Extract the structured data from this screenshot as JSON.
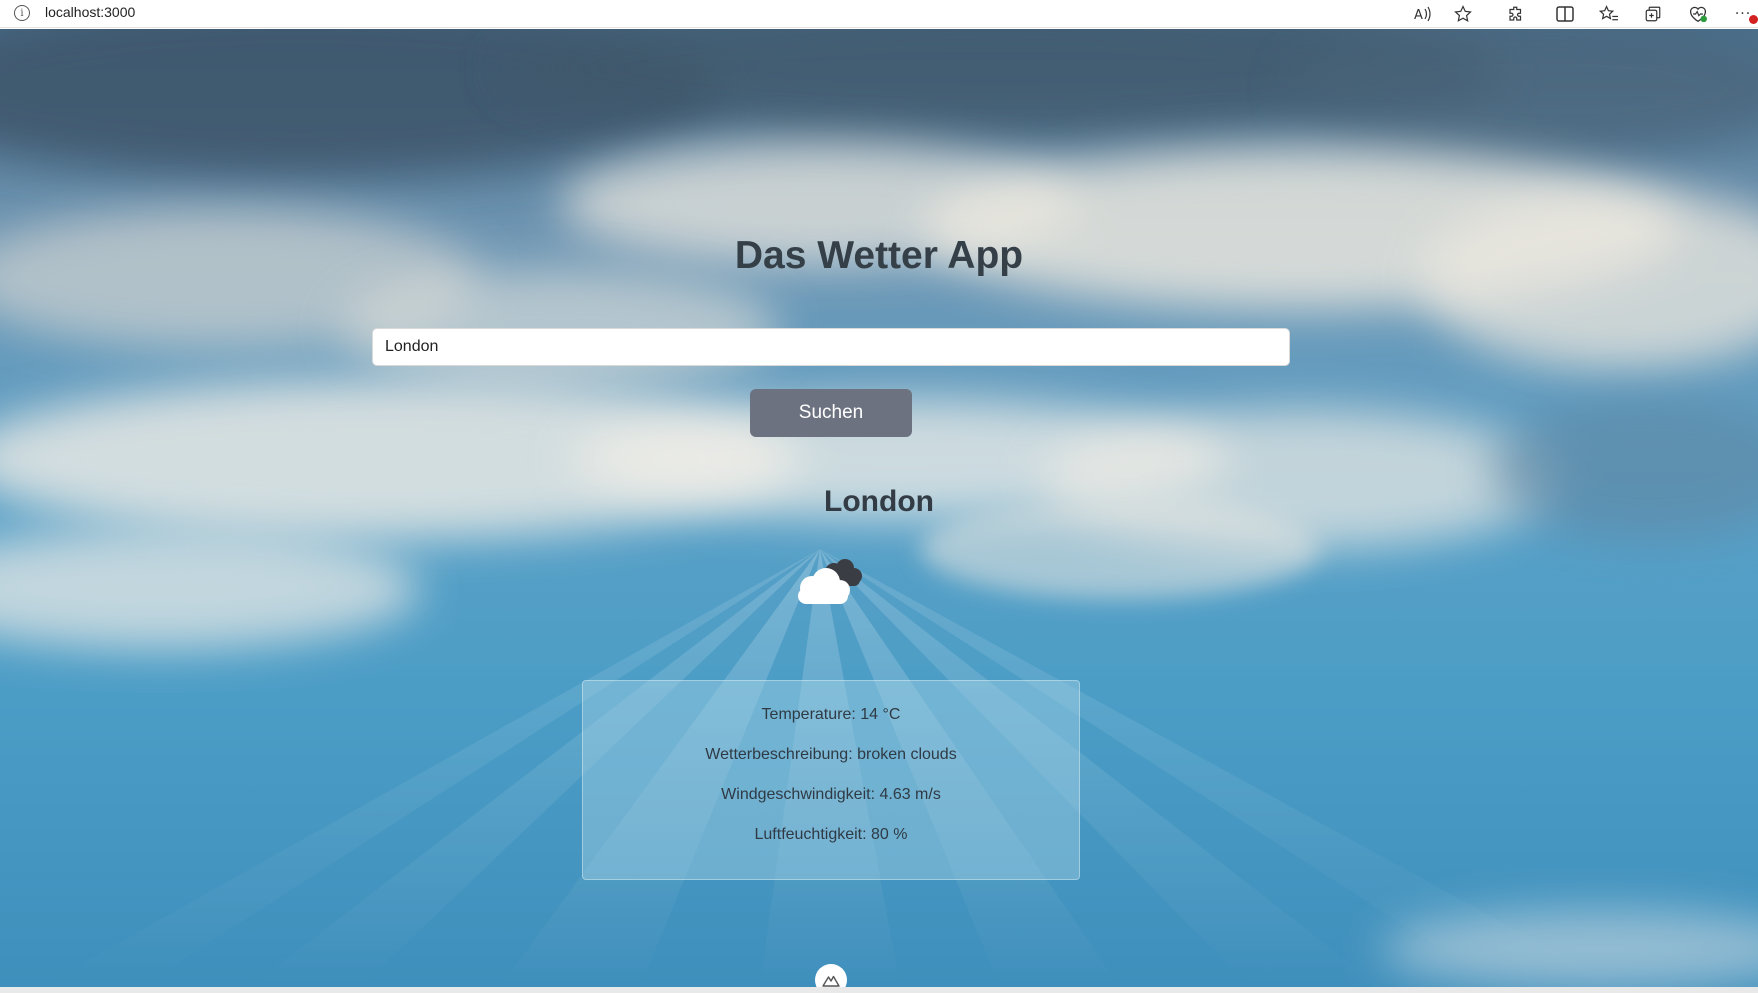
{
  "browser": {
    "url": "localhost:3000",
    "notification_color": "#d32020"
  },
  "app": {
    "title": "Das Wetter App",
    "search": {
      "value": "London",
      "button_label": "Suchen"
    },
    "city": "London",
    "weather_icon": "broken-clouds-icon",
    "details": {
      "temperature": "Temperature: 14 °C",
      "description": "Wetterbeschreibung: broken clouds",
      "wind": "Windgeschwindigkeit: 4.63 m/s",
      "humidity": "Luftfeuchtigkeit: 80 %"
    }
  },
  "colors": {
    "button": "#6c7280",
    "title_text": "#353f48",
    "card_bg": "rgba(170,212,230,0.42)"
  }
}
